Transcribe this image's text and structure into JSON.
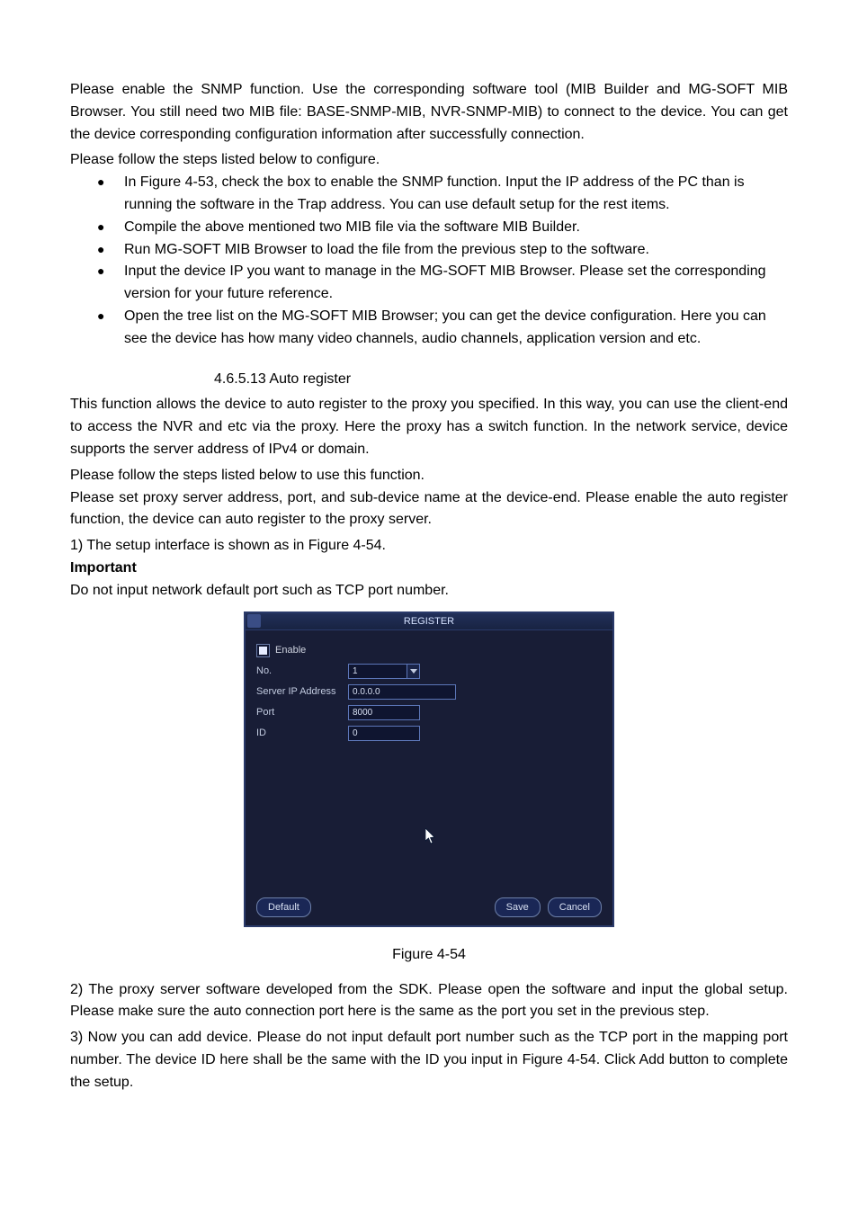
{
  "para_snmp_intro": "Please enable the SNMP function. Use the corresponding software tool (MIB Builder and MG-SOFT MIB Browser. You still need two MIB file: BASE-SNMP-MIB, NVR-SNMP-MIB) to connect to the device. You can get the device corresponding configuration information after successfully connection.",
  "para_steps_intro": "Please follow the steps listed below to configure.",
  "bullets": [
    "In Figure 4-53, check the box to enable the SNMP function. Input the IP address of the PC than is running the software in the Trap address. You can use default setup for the rest items.",
    "Compile the above mentioned two MIB file via the software MIB Builder.",
    "Run MG-SOFT MIB Browser to load the file from the previous step to the software.",
    "Input the device IP you want to manage in the MG-SOFT MIB Browser. Please set the corresponding version for your future reference.",
    "Open the tree list on the MG-SOFT MIB Browser; you can get the device configuration. Here you can see the device has how many video channels, audio channels, application version and etc."
  ],
  "section_heading": "4.6.5.13  Auto register",
  "para_autoreg_intro": "This function allows the device to auto register to the proxy you specified. In this way, you can use the client-end to access the NVR and etc via the proxy. Here the proxy has a switch function. In the network service, device supports the server address of IPv4 or domain.",
  "para_autoreg_steps_intro": "Please follow the steps listed below to use this function.",
  "para_autoreg_proxy": "Please set proxy server address, port, and sub-device name at the device-end. Please enable the auto register function, the device can auto register to the proxy server.",
  "step1": "1) The setup interface is shown as in Figure 4-54.",
  "important_heading": "Important",
  "important_text": "Do not input network default port such as TCP port number.",
  "dialog": {
    "title": "REGISTER",
    "enable_label": "Enable",
    "fields": {
      "no": {
        "label": "No.",
        "value": "1"
      },
      "server_ip": {
        "label": "Server IP Address",
        "value": "0.0.0.0"
      },
      "port": {
        "label": "Port",
        "value": "8000"
      },
      "id": {
        "label": "ID",
        "value": "0"
      }
    },
    "buttons": {
      "default": "Default",
      "save": "Save",
      "cancel": "Cancel"
    }
  },
  "figure_caption": "Figure 4-54",
  "step2": "2) The proxy server software developed from the SDK. Please open the software and input the global setup. Please make sure the auto connection port here is the same as the port you set in the previous step.",
  "step3": "3) Now you can add device. Please do not input default port number such as the TCP port in the mapping port number. The device ID here shall be the same with the ID you input in Figure 4-54. Click Add button to complete the setup."
}
